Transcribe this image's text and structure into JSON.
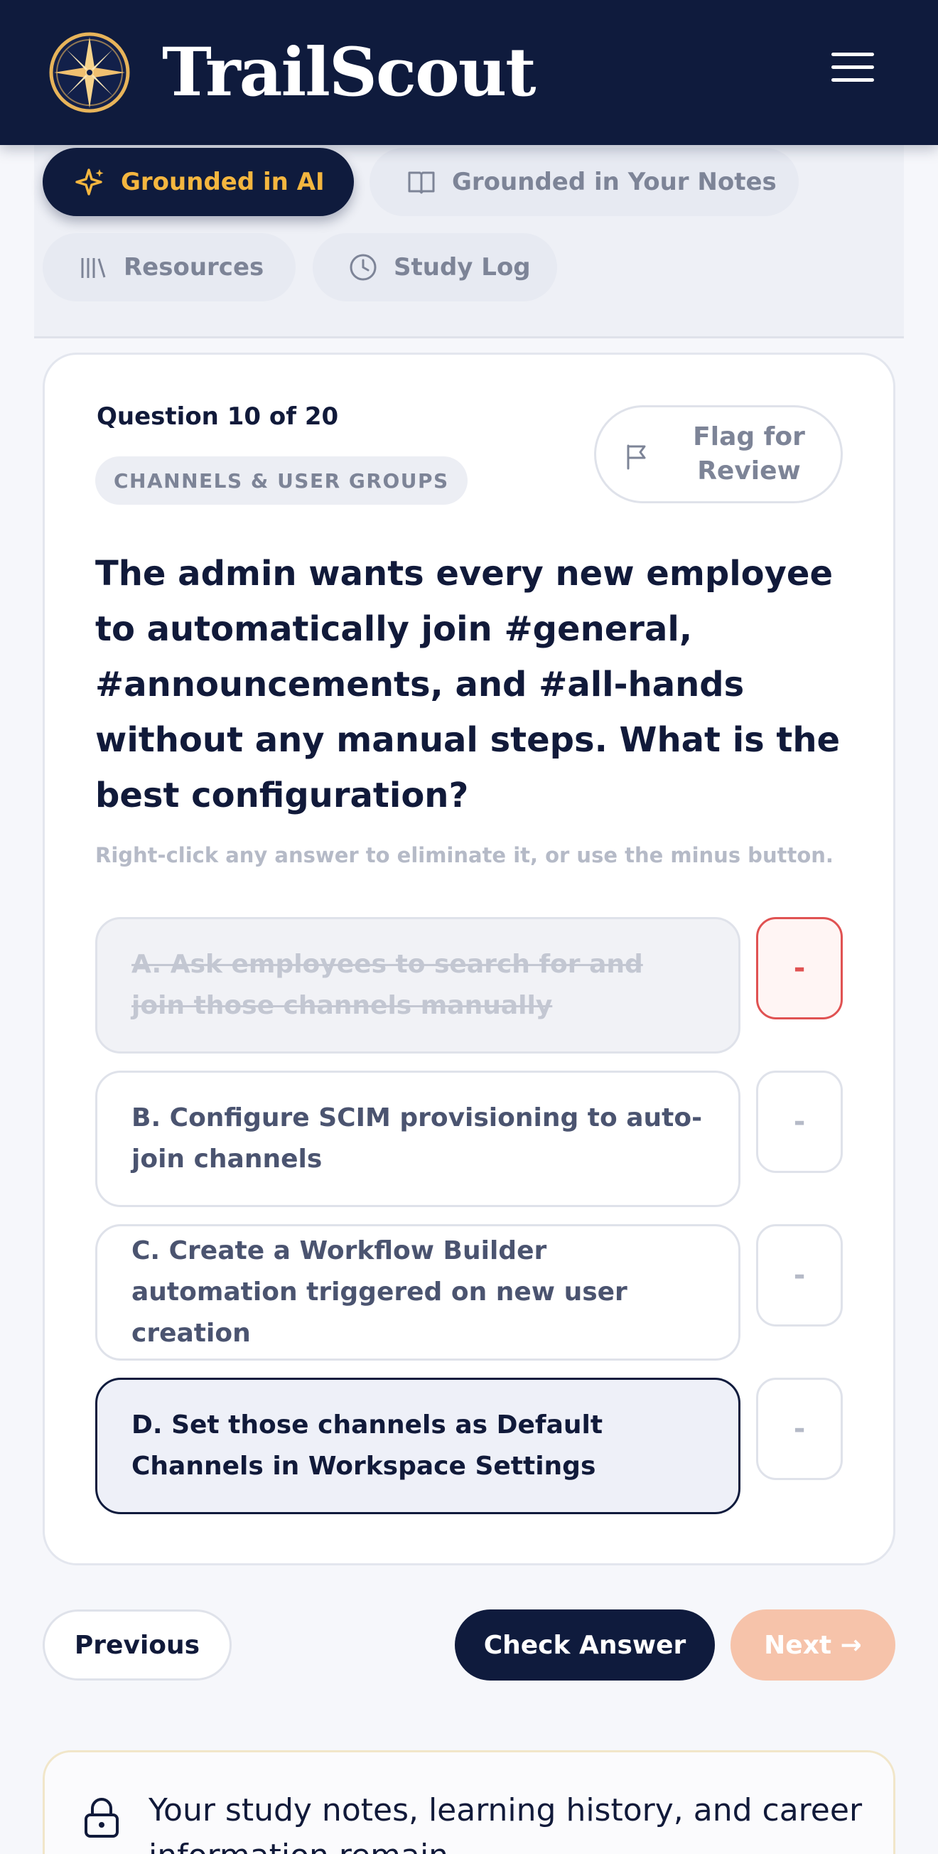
{
  "app": {
    "brand": "TrailScout"
  },
  "tabs": [
    {
      "label": "Grounded in AI",
      "icon": "sparkle-icon",
      "active": true
    },
    {
      "label": "Grounded in Your Notes",
      "icon": "book-icon",
      "active": false
    },
    {
      "label": "Resources",
      "icon": "library-icon",
      "active": false
    },
    {
      "label": "Study Log",
      "icon": "clock-icon",
      "active": false
    }
  ],
  "quiz": {
    "progress": "Question 10 of 20",
    "topic": "CHANNELS & USER GROUPS",
    "flag_label": "Flag for Review",
    "question": "The admin wants every new employee to automatically join #general, #announcements, and #all-hands without any manual steps. What is the best configuration?",
    "hint": "Right-click any answer to eliminate it, or use the minus button.",
    "options": [
      {
        "label": "A. Ask employees to search for and join those channels manually",
        "state": "eliminated"
      },
      {
        "label": "B. Configure SCIM provisioning to auto-join channels",
        "state": "normal"
      },
      {
        "label": "C. Create a Workflow Builder automation triggered on new user creation",
        "state": "normal"
      },
      {
        "label": "D. Set those channels as Default Channels in Workspace Settings",
        "state": "selected"
      }
    ],
    "eliminate_label": "-"
  },
  "nav": {
    "previous": "Previous",
    "check": "Check Answer",
    "next": "Next →"
  },
  "notice": {
    "text": "Your study notes, learning history, and career information remain"
  },
  "colors": {
    "navy": "#0f1b3d",
    "gold": "#f4b63f",
    "danger": "#e05252",
    "next_disabled": "#f6c3aa"
  }
}
